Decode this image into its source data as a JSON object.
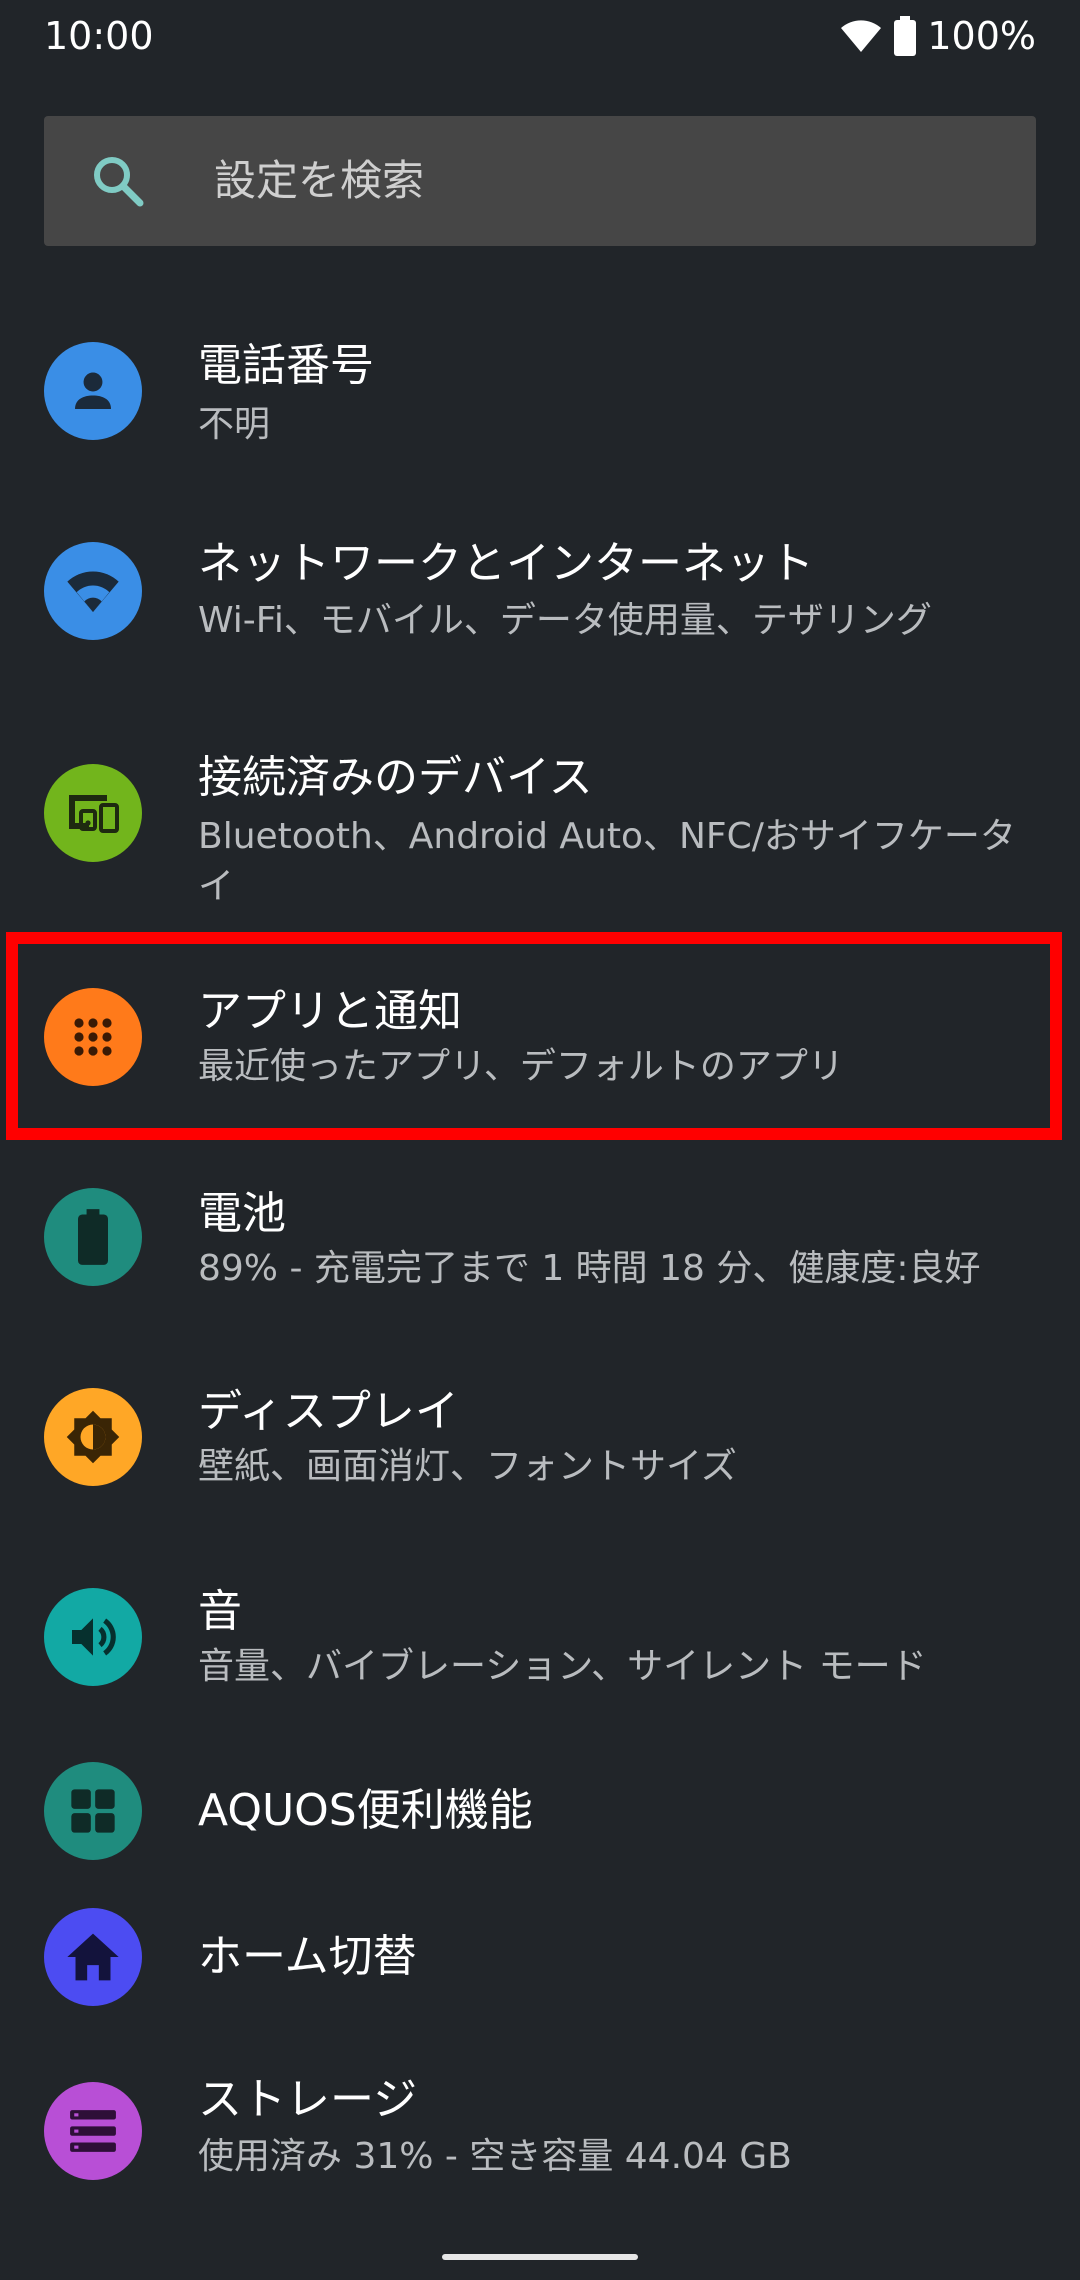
{
  "status_bar": {
    "time": "10:00",
    "battery": "100%"
  },
  "search": {
    "placeholder": "設定を検索"
  },
  "items": [
    {
      "title": "電話番号",
      "subtitle": "不明",
      "icon": "person-icon",
      "color": "#3a8ee6"
    },
    {
      "title": "ネットワークとインターネット",
      "subtitle": "Wi-Fi、モバイル、データ使用量、テザリング",
      "icon": "wifi-icon",
      "color": "#3a8ee6"
    },
    {
      "title": "接続済みのデバイス",
      "subtitle": "Bluetooth、Android Auto、NFC/おサイフケータイ",
      "icon": "devices-icon",
      "color": "#72b51c"
    },
    {
      "title": "アプリと通知",
      "subtitle": "最近使ったアプリ、デフォルトのアプリ",
      "icon": "apps-grid-icon",
      "color": "#ff7a1a"
    },
    {
      "title": "電池",
      "subtitle": "89% - 充電完了まで 1 時間 18 分、健康度:良好",
      "icon": "battery-icon",
      "color": "#1f8c7e"
    },
    {
      "title": "ディスプレイ",
      "subtitle": "壁紙、画面消灯、フォントサイズ",
      "icon": "brightness-icon",
      "color": "#ffa726"
    },
    {
      "title": "音",
      "subtitle": "音量、バイブレーション、サイレント モード",
      "icon": "volume-icon",
      "color": "#12a9a4"
    },
    {
      "title": "AQUOS便利機能",
      "subtitle": "",
      "icon": "dashboard-icon",
      "color": "#1f8c7e"
    },
    {
      "title": "ホーム切替",
      "subtitle": "",
      "icon": "home-icon",
      "color": "#4c4cf2"
    },
    {
      "title": "ストレージ",
      "subtitle": "使用済み 31% - 空き容量 44.04 GB",
      "icon": "storage-icon",
      "color": "#b84fd6"
    }
  ],
  "colors": {
    "background": "#212529",
    "search_bg": "#464646",
    "highlight": "#ff0000",
    "accent_search_icon": "#80cbc4"
  }
}
